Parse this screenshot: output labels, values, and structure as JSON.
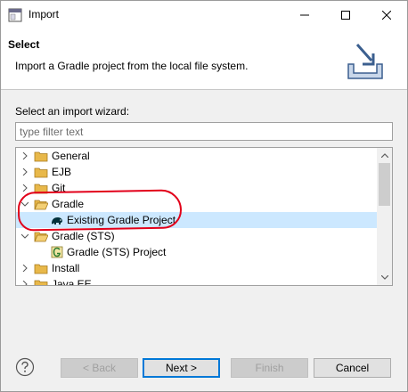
{
  "window": {
    "title": "Import",
    "minimize_icon": "minimize-icon",
    "maximize_icon": "maximize-icon",
    "close_icon": "close-icon"
  },
  "header": {
    "title": "Select",
    "description": "Import a Gradle project from the local file system."
  },
  "wizard": {
    "label": "Select an import wizard:",
    "filter_placeholder": "type filter text",
    "filter_value": ""
  },
  "tree": {
    "items": [
      {
        "label": "General",
        "level": 0,
        "expanded": false,
        "icon": "folder-icon"
      },
      {
        "label": "EJB",
        "level": 0,
        "expanded": false,
        "icon": "folder-icon"
      },
      {
        "label": "Git",
        "level": 0,
        "expanded": false,
        "icon": "folder-icon"
      },
      {
        "label": "Gradle",
        "level": 0,
        "expanded": true,
        "icon": "folder-icon"
      },
      {
        "label": "Existing Gradle Project",
        "level": 1,
        "selected": true,
        "icon": "gradle-elephant-icon"
      },
      {
        "label": "Gradle (STS)",
        "level": 0,
        "expanded": true,
        "icon": "folder-icon"
      },
      {
        "label": "Gradle (STS) Project",
        "level": 1,
        "icon": "gradle-sts-icon"
      },
      {
        "label": "Install",
        "level": 0,
        "expanded": false,
        "icon": "folder-icon"
      },
      {
        "label": "Java EE",
        "level": 0,
        "expanded": false,
        "icon": "folder-icon"
      }
    ]
  },
  "buttons": {
    "help_icon": "help-icon",
    "back": "< Back",
    "next": "Next >",
    "finish": "Finish",
    "cancel": "Cancel"
  },
  "colors": {
    "selection": "#cce8ff",
    "annotation": "#e2001a",
    "folder": "#e8b84a"
  }
}
